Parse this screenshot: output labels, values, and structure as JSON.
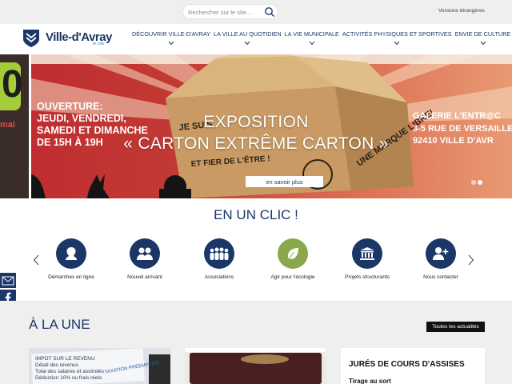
{
  "topbar": {
    "search_placeholder": "Rechercher sur le site...",
    "versions_link": "Versions étrangères"
  },
  "header": {
    "logo_text": "Ville-d'Avray",
    "logo_subtext": "le site",
    "nav": [
      {
        "label": "DÉCOUVRIR VILLE-D'AVRAY"
      },
      {
        "label": "LA VILLE AU QUOTIDIEN"
      },
      {
        "label": "LA VIE MUNICIPALE"
      },
      {
        "label": "ACTIVITÉS PHYSIQUES ET SPORTIVES"
      },
      {
        "label": "ENVIE DE CULTURE"
      }
    ]
  },
  "hero": {
    "left_panel_big": "0",
    "left_panel_small": "mai",
    "ouverture_lines": [
      "OUVERTURE:",
      "JEUDI, VENDREDI,",
      "SAMEDI ET DIMANCHE",
      "DE 15H À 19H"
    ],
    "galerie_lines": [
      "GALERIE L'ENTR@C",
      "3-5 RUE DE VERSAILLE",
      "92410 VILLE D'AVR"
    ],
    "title_line1": "EXPOSITION",
    "title_line2": "« CARTON EXTRÊME CARTON »",
    "cta_label": "en savoir plus",
    "slide_count": 2,
    "active_slide": 2
  },
  "en_un_clic": {
    "title": "EN UN CLIC !",
    "items": [
      {
        "label": "Démarches en ligne",
        "icon": "person-profile-icon",
        "color": "#1b3768"
      },
      {
        "label": "Nouvel arrivant",
        "icon": "users-icon",
        "color": "#1b3768"
      },
      {
        "label": "Associations",
        "icon": "group-icon",
        "color": "#1b3768"
      },
      {
        "label": "Agir pour l'écologie",
        "icon": "leaf-icon",
        "color": "#8aa84b"
      },
      {
        "label": "Projets structurants",
        "icon": "building-icon",
        "color": "#1b3768"
      },
      {
        "label": "Nous contacter",
        "icon": "add-contact-icon",
        "color": "#1b3768"
      }
    ]
  },
  "social": [
    "newsletter-icon",
    "facebook-icon",
    "instagram-icon",
    "linkedin-icon"
  ],
  "a_la_une": {
    "title": "À LA UNE",
    "all_news_label": "Toutes les actualités",
    "card1_lines": [
      "IMPOT SUR LE REVENU",
      "Détail des revenus",
      "Total des salaires et assimilés",
      "Déduction 10% ou frais réels"
    ],
    "card3_title": "JURÉS DE COURS D'ASSISES",
    "card3_subtitle": "Tirage au sort"
  },
  "colors": {
    "brand_navy": "#1b3768",
    "eco_green": "#8aa84b",
    "light_grey": "#efefef"
  }
}
